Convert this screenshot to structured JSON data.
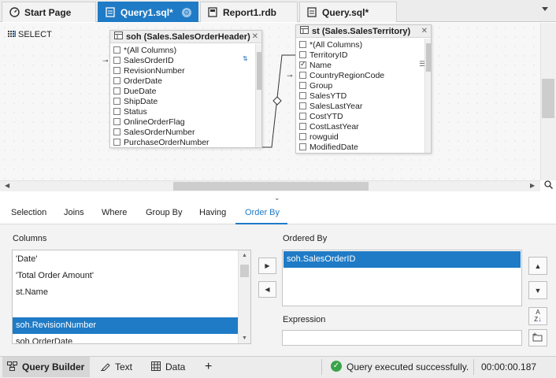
{
  "tabs": [
    {
      "label": "Start Page",
      "icon": "home-gauge-icon"
    },
    {
      "label": "Query1.sql*",
      "icon": "sql-file-icon",
      "active": true
    },
    {
      "label": "Report1.rdb",
      "icon": "report-icon"
    },
    {
      "label": "Query.sql*",
      "icon": "sql-file-icon"
    }
  ],
  "diagram": {
    "select_label": "SELECT",
    "table1": {
      "title": "soh (Sales.SalesOrderHeader)",
      "fields": [
        "*(All Columns)",
        "SalesOrderID",
        "RevisionNumber",
        "OrderDate",
        "DueDate",
        "ShipDate",
        "Status",
        "OnlineOrderFlag",
        "SalesOrderNumber",
        "PurchaseOrderNumber"
      ]
    },
    "table2": {
      "title": "st (Sales.SalesTerritory)",
      "fields": [
        "*(All Columns)",
        "TerritoryID",
        "Name",
        "CountryRegionCode",
        "Group",
        "SalesYTD",
        "SalesLastYear",
        "CostYTD",
        "CostLastYear",
        "rowguid",
        "ModifiedDate"
      ],
      "checked": [
        "Name"
      ]
    }
  },
  "clause_tabs": [
    "Selection",
    "Joins",
    "Where",
    "Group By",
    "Having",
    "Order By"
  ],
  "active_clause_tab": "Order By",
  "order_by": {
    "columns_label": "Columns",
    "columns": [
      "'Date'",
      "'Total Order Amount'",
      "st.Name",
      "",
      "soh.RevisionNumber",
      "soh.OrderDate"
    ],
    "selected_column": "soh.RevisionNumber",
    "ordered_by_label": "Ordered By",
    "ordered_by": [
      "soh.SalesOrderID"
    ],
    "expression_label": "Expression",
    "expression_value": ""
  },
  "statusbar": {
    "views": [
      {
        "label": "Query Builder",
        "icon": "query-builder-icon",
        "active": true
      },
      {
        "label": "Text",
        "icon": "text-icon"
      },
      {
        "label": "Data",
        "icon": "data-grid-icon"
      }
    ],
    "add_label": "+",
    "status_message": "Query executed successfully.",
    "elapsed": "00:00:00.187"
  },
  "colors": {
    "accent": "#1f7bc6",
    "success": "#3aa34a"
  }
}
